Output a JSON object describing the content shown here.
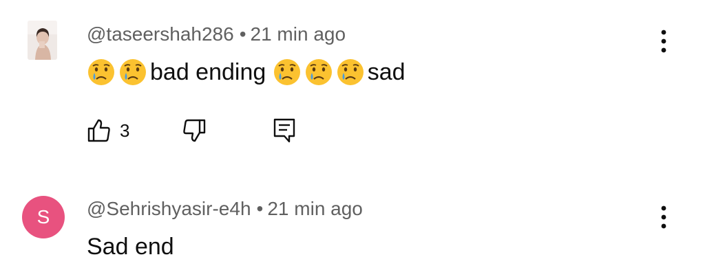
{
  "comments": [
    {
      "author": "@taseershah286",
      "separator": "•",
      "time": "21 min ago",
      "avatar_type": "photo",
      "text_parts": [
        {
          "kind": "emoji",
          "name": "crying-face-emoji"
        },
        {
          "kind": "emoji",
          "name": "crying-face-emoji"
        },
        {
          "kind": "text",
          "value": "bad ending "
        },
        {
          "kind": "emoji",
          "name": "crying-face-emoji"
        },
        {
          "kind": "emoji",
          "name": "crying-face-emoji"
        },
        {
          "kind": "emoji",
          "name": "crying-face-emoji"
        },
        {
          "kind": "text",
          "value": "sad"
        }
      ],
      "like_count": "3",
      "icons": {
        "like": "thumbs-up-icon",
        "dislike": "thumbs-down-icon",
        "reply": "reply-comment-icon",
        "menu": "more-vertical-icon"
      }
    },
    {
      "author": "@Sehrishyasir-e4h",
      "separator": "•",
      "time": "21 min ago",
      "avatar_type": "letter",
      "avatar_letter": "S",
      "avatar_color": "#e8527f",
      "text": "Sad end",
      "icons": {
        "menu": "more-vertical-icon"
      }
    }
  ],
  "colors": {
    "meta_text": "#606060",
    "body_text": "#0f0f0f",
    "background": "#ffffff",
    "emoji_face": "#fbc230",
    "emoji_tear": "#4a9ce0"
  }
}
